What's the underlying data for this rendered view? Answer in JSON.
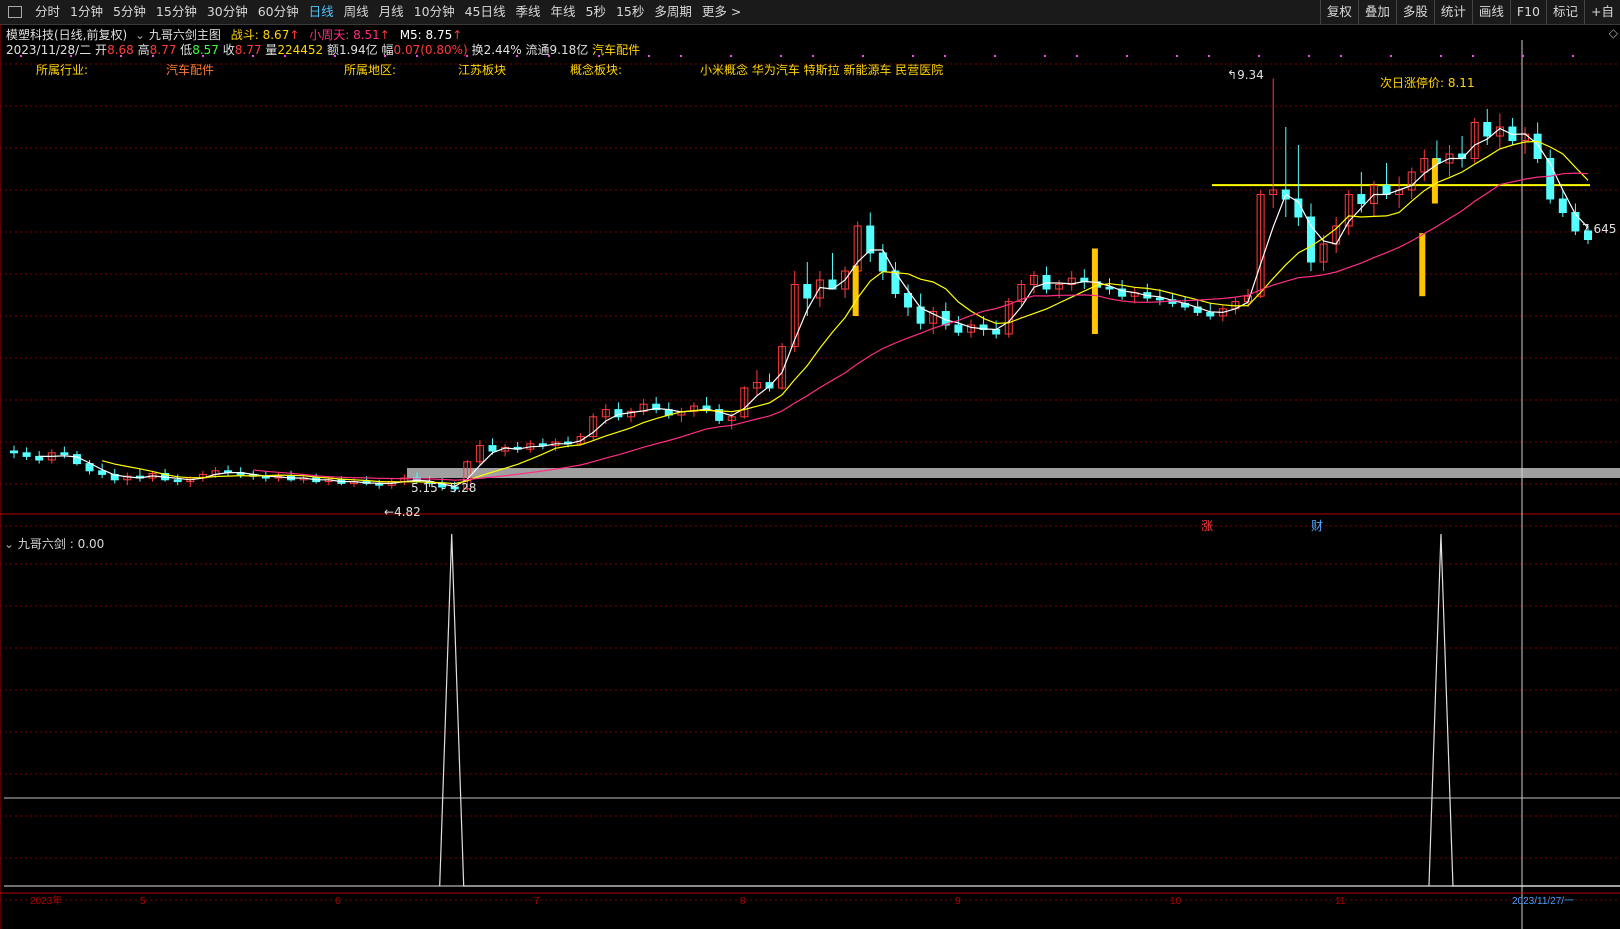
{
  "toolbar": {
    "tabs": [
      "分时",
      "1分钟",
      "5分钟",
      "15分钟",
      "30分钟",
      "60分钟",
      "日线",
      "周线",
      "月线",
      "10分钟",
      "45日线",
      "季线",
      "年线",
      "5秒",
      "15秒",
      "多周期",
      "更多 >"
    ],
    "active_tab": "日线",
    "right_tabs": [
      "复权",
      "叠加",
      "多股",
      "统计",
      "画线",
      "F10",
      "标记",
      "+自"
    ]
  },
  "stock": {
    "name": "模塑科技(日线,前复权)",
    "indicator_name": "九哥六剑主图",
    "zhandou": "战斗: 8.67",
    "xiaozhoutian": "小周天: 8.51",
    "m5": "M5: 8.75",
    "date": "2023/11/28/二",
    "open_label": "开",
    "open": "8.68",
    "high_label": "高",
    "high": "8.77",
    "low_label": "低",
    "low": "8.57",
    "close_label": "收",
    "close": "8.77",
    "vol_label": "量",
    "vol": "224452",
    "amount": "额1.94亿",
    "change_label": "幅",
    "change": "0.07(0.80%)",
    "turnover": "换2.44%",
    "float_cap": "流通9.18亿",
    "sector_tag": "汽车配件"
  },
  "blocks": {
    "industry_label": "所属行业:",
    "industry": "汽车配件",
    "region_label": "所属地区:",
    "region": "江苏板块",
    "concept_label": "概念板块:",
    "concepts": "小米概念 华为汽车 特斯拉 新能源车 民营医院"
  },
  "annotations": {
    "high_mark": "9.34",
    "low_mark": "4.82",
    "range_mark": "5.15 - 5.28",
    "next_limit": "次日涨停价: 8.11",
    "last_mark": "7.645",
    "zhang_flag": "涨",
    "cai_flag": "财"
  },
  "sub_indicator": {
    "title": "九哥六剑",
    "value": ": 0.00"
  },
  "x_axis": [
    "2023年",
    "5",
    "6",
    "7",
    "8",
    "9",
    "10",
    "11",
    "2023/11/27/一"
  ],
  "colors": {
    "up": "#ff3b3b",
    "down": "#54ffff",
    "ma_white": "#ffffff",
    "ma_yellow": "#ffff00",
    "ma_pink": "#ff2e84",
    "signal_bar": "#ffc400",
    "grid": "#7a0000",
    "text_yellow": "#ffd400"
  },
  "chart_data": {
    "type": "candlestick",
    "ylim": [
      4.5,
      9.5
    ],
    "high_point": 9.34,
    "low_point": 4.82,
    "limit_line": 8.11,
    "last_close_mark": 7.645,
    "ohlc": [
      [
        5.2,
        5.26,
        5.12,
        5.18
      ],
      [
        5.18,
        5.24,
        5.1,
        5.14
      ],
      [
        5.14,
        5.2,
        5.06,
        5.1
      ],
      [
        5.1,
        5.22,
        5.06,
        5.18
      ],
      [
        5.18,
        5.25,
        5.12,
        5.16
      ],
      [
        5.16,
        5.2,
        5.04,
        5.06
      ],
      [
        5.06,
        5.1,
        4.94,
        4.98
      ],
      [
        4.98,
        5.06,
        4.9,
        4.94
      ],
      [
        4.94,
        5.0,
        4.84,
        4.88
      ],
      [
        4.88,
        4.96,
        4.82,
        4.92
      ],
      [
        4.92,
        5.0,
        4.86,
        4.9
      ],
      [
        4.9,
        4.98,
        4.86,
        4.95
      ],
      [
        4.95,
        5.0,
        4.86,
        4.88
      ],
      [
        4.88,
        4.94,
        4.82,
        4.86
      ],
      [
        4.86,
        4.92,
        4.8,
        4.9
      ],
      [
        4.9,
        4.98,
        4.86,
        4.94
      ],
      [
        4.94,
        5.02,
        4.9,
        4.98
      ],
      [
        4.98,
        5.04,
        4.92,
        4.96
      ],
      [
        4.96,
        5.02,
        4.9,
        4.94
      ],
      [
        4.94,
        4.98,
        4.88,
        4.92
      ],
      [
        4.92,
        4.98,
        4.86,
        4.9
      ],
      [
        4.9,
        4.96,
        4.86,
        4.92
      ],
      [
        4.92,
        4.98,
        4.86,
        4.88
      ],
      [
        4.88,
        4.94,
        4.84,
        4.9
      ],
      [
        4.9,
        4.95,
        4.84,
        4.86
      ],
      [
        4.86,
        4.92,
        4.82,
        4.88
      ],
      [
        4.88,
        4.92,
        4.82,
        4.84
      ],
      [
        4.84,
        4.9,
        4.8,
        4.86
      ],
      [
        4.86,
        4.92,
        4.82,
        4.84
      ],
      [
        4.84,
        4.88,
        4.78,
        4.82
      ],
      [
        4.82,
        4.9,
        4.78,
        4.86
      ],
      [
        4.86,
        4.94,
        4.82,
        4.9
      ],
      [
        4.9,
        4.96,
        4.84,
        4.86
      ],
      [
        4.86,
        4.92,
        4.8,
        4.84
      ],
      [
        4.84,
        4.9,
        4.76,
        4.8
      ],
      [
        4.8,
        4.86,
        4.74,
        4.78
      ],
      [
        4.78,
        5.1,
        4.76,
        5.08
      ],
      [
        5.08,
        5.32,
        5.04,
        5.26
      ],
      [
        5.26,
        5.34,
        5.16,
        5.2
      ],
      [
        5.2,
        5.28,
        5.14,
        5.24
      ],
      [
        5.24,
        5.3,
        5.18,
        5.22
      ],
      [
        5.22,
        5.32,
        5.18,
        5.28
      ],
      [
        5.28,
        5.34,
        5.22,
        5.26
      ],
      [
        5.26,
        5.34,
        5.2,
        5.3
      ],
      [
        5.3,
        5.36,
        5.24,
        5.28
      ],
      [
        5.28,
        5.4,
        5.26,
        5.36
      ],
      [
        5.36,
        5.62,
        5.32,
        5.58
      ],
      [
        5.58,
        5.72,
        5.5,
        5.66
      ],
      [
        5.66,
        5.74,
        5.54,
        5.58
      ],
      [
        5.58,
        5.68,
        5.52,
        5.64
      ],
      [
        5.64,
        5.78,
        5.6,
        5.72
      ],
      [
        5.72,
        5.8,
        5.62,
        5.66
      ],
      [
        5.66,
        5.74,
        5.56,
        5.6
      ],
      [
        5.6,
        5.68,
        5.52,
        5.64
      ],
      [
        5.64,
        5.74,
        5.58,
        5.7
      ],
      [
        5.7,
        5.8,
        5.62,
        5.66
      ],
      [
        5.66,
        5.72,
        5.5,
        5.54
      ],
      [
        5.54,
        5.62,
        5.44,
        5.58
      ],
      [
        5.58,
        5.92,
        5.56,
        5.9
      ],
      [
        5.9,
        6.1,
        5.82,
        5.96
      ],
      [
        5.96,
        6.06,
        5.86,
        5.9
      ],
      [
        5.9,
        6.4,
        5.88,
        6.36
      ],
      [
        6.36,
        7.2,
        6.3,
        7.05
      ],
      [
        7.05,
        7.3,
        6.7,
        6.9
      ],
      [
        6.9,
        7.2,
        6.8,
        7.1
      ],
      [
        7.1,
        7.4,
        7.0,
        7.0
      ],
      [
        7.0,
        7.25,
        6.9,
        7.2
      ],
      [
        7.2,
        7.75,
        7.1,
        7.7
      ],
      [
        7.7,
        7.85,
        7.3,
        7.4
      ],
      [
        7.4,
        7.5,
        7.1,
        7.2
      ],
      [
        7.2,
        7.3,
        6.9,
        6.95
      ],
      [
        6.95,
        7.05,
        6.7,
        6.8
      ],
      [
        6.8,
        6.95,
        6.55,
        6.62
      ],
      [
        6.62,
        6.8,
        6.5,
        6.75
      ],
      [
        6.75,
        6.85,
        6.55,
        6.6
      ],
      [
        6.6,
        6.7,
        6.48,
        6.52
      ],
      [
        6.52,
        6.66,
        6.46,
        6.6
      ],
      [
        6.6,
        6.7,
        6.48,
        6.55
      ],
      [
        6.55,
        6.65,
        6.45,
        6.5
      ],
      [
        6.5,
        6.9,
        6.46,
        6.86
      ],
      [
        6.86,
        7.1,
        6.8,
        7.05
      ],
      [
        7.05,
        7.2,
        6.95,
        7.15
      ],
      [
        7.15,
        7.25,
        6.95,
        7.0
      ],
      [
        7.0,
        7.1,
        6.9,
        7.05
      ],
      [
        7.05,
        7.2,
        6.98,
        7.12
      ],
      [
        7.12,
        7.22,
        7.0,
        7.08
      ],
      [
        7.08,
        7.18,
        6.96,
        7.02
      ],
      [
        7.02,
        7.12,
        6.94,
        7.0
      ],
      [
        7.0,
        7.1,
        6.88,
        6.92
      ],
      [
        6.92,
        7.02,
        6.84,
        6.96
      ],
      [
        6.96,
        7.06,
        6.86,
        6.9
      ],
      [
        6.9,
        7.0,
        6.82,
        6.88
      ],
      [
        6.88,
        6.96,
        6.8,
        6.84
      ],
      [
        6.84,
        6.92,
        6.76,
        6.8
      ],
      [
        6.8,
        6.88,
        6.7,
        6.74
      ],
      [
        6.74,
        6.84,
        6.66,
        6.7
      ],
      [
        6.7,
        6.82,
        6.64,
        6.78
      ],
      [
        6.78,
        6.9,
        6.72,
        6.86
      ],
      [
        6.86,
        7.0,
        6.8,
        6.92
      ],
      [
        6.92,
        8.1,
        6.9,
        8.05
      ],
      [
        8.05,
        9.34,
        7.9,
        8.1
      ],
      [
        8.1,
        8.8,
        7.8,
        8.0
      ],
      [
        8.0,
        8.6,
        7.7,
        7.8
      ],
      [
        7.8,
        7.95,
        7.2,
        7.3
      ],
      [
        7.3,
        7.6,
        7.2,
        7.5
      ],
      [
        7.5,
        7.8,
        7.4,
        7.7
      ],
      [
        7.7,
        8.1,
        7.6,
        8.05
      ],
      [
        8.05,
        8.3,
        7.85,
        7.95
      ],
      [
        7.95,
        8.2,
        7.8,
        8.15
      ],
      [
        8.15,
        8.4,
        8.0,
        8.05
      ],
      [
        8.05,
        8.25,
        7.9,
        8.1
      ],
      [
        8.1,
        8.35,
        8.0,
        8.3
      ],
      [
        8.3,
        8.55,
        8.2,
        8.45
      ],
      [
        8.45,
        8.65,
        8.3,
        8.4
      ],
      [
        8.4,
        8.6,
        8.25,
        8.5
      ],
      [
        8.5,
        8.7,
        8.35,
        8.45
      ],
      [
        8.45,
        8.9,
        8.4,
        8.85
      ],
      [
        8.85,
        9.0,
        8.6,
        8.7
      ],
      [
        8.7,
        8.95,
        8.55,
        8.8
      ],
      [
        8.8,
        8.9,
        8.6,
        8.65
      ],
      [
        8.65,
        8.8,
        8.5,
        8.72
      ],
      [
        8.72,
        8.85,
        8.4,
        8.45
      ],
      [
        8.45,
        8.55,
        7.95,
        8.0
      ],
      [
        8.0,
        8.1,
        7.8,
        7.85
      ],
      [
        7.85,
        7.95,
        7.6,
        7.645
      ],
      [
        7.645,
        7.7,
        7.5,
        7.55
      ]
    ]
  },
  "sub_chart_data": {
    "type": "line",
    "series_values": {
      "spike_positions": [
        0.285,
        0.908
      ]
    }
  }
}
